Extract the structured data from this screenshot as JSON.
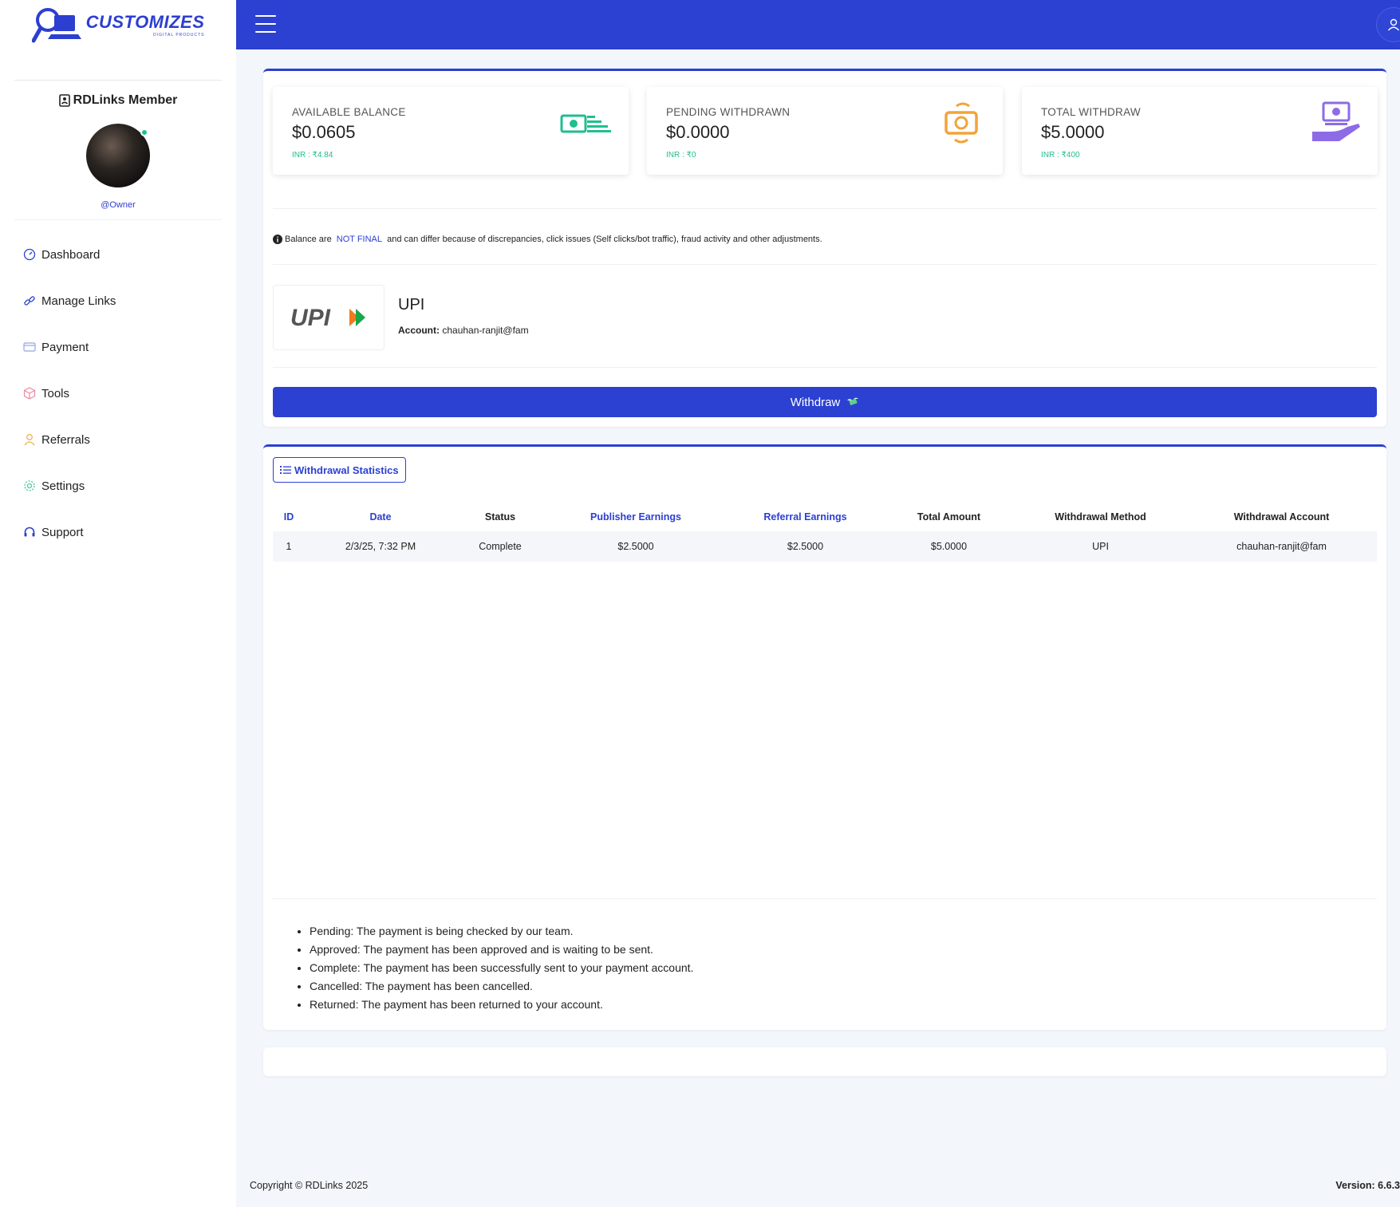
{
  "brand": {
    "name": "CUSTOMIZES",
    "tagline": "DIGITAL PRODUCTS"
  },
  "sidebar": {
    "member_label": "RDLinks Member",
    "username": "@Owner",
    "items": [
      {
        "label": "Dashboard",
        "icon": "gauge-icon"
      },
      {
        "label": "Manage Links",
        "icon": "link-icon"
      },
      {
        "label": "Payment",
        "icon": "card-icon"
      },
      {
        "label": "Tools",
        "icon": "cube-icon"
      },
      {
        "label": "Referrals",
        "icon": "user-icon"
      },
      {
        "label": "Settings",
        "icon": "gear-icon"
      },
      {
        "label": "Support",
        "icon": "headset-icon"
      }
    ]
  },
  "stats": [
    {
      "label": "AVAILABLE BALANCE",
      "value": "$0.0605",
      "inr": "INR : ₹4.84",
      "icon": "cash-stack-icon",
      "color": "#1fbf8f"
    },
    {
      "label": "PENDING WITHDRAWN",
      "value": "$0.0000",
      "inr": "INR : ₹0",
      "icon": "cash-refresh-icon",
      "color": "#f2a33a"
    },
    {
      "label": "TOTAL WITHDRAW",
      "value": "$5.0000",
      "inr": "INR : ₹400",
      "icon": "hand-cash-icon",
      "color": "#8d6be6"
    }
  ],
  "notice": {
    "prefix": "Balance are ",
    "highlight": "NOT FINAL",
    "suffix": " and can differ because of discrepancies, click issues (Self clicks/bot traffic), fraud activity and other adjustments."
  },
  "payment_method": {
    "logo_text": "UPI",
    "name": "UPI",
    "account_label": "Account:",
    "account_value": "chauhan-ranjit@fam"
  },
  "withdraw_button": "Withdraw",
  "withdrawal_stats": {
    "tab_label": "Withdrawal Statistics",
    "columns": [
      "ID",
      "Date",
      "Status",
      "Publisher Earnings",
      "Referral Earnings",
      "Total Amount",
      "Withdrawal Method",
      "Withdrawal Account"
    ],
    "rows": [
      [
        "1",
        "2/3/25, 7:32 PM",
        "Complete",
        "$2.5000",
        "$2.5000",
        "$5.0000",
        "UPI",
        "chauhan-ranjit@fam"
      ]
    ]
  },
  "legend": [
    "Pending: The payment is being checked by our team.",
    "Approved: The payment has been approved and is waiting to be sent.",
    "Complete: The payment has been successfully sent to your payment account.",
    "Cancelled: The payment has been cancelled.",
    "Returned: The payment has been returned to your account."
  ],
  "footer": {
    "copyright": "Copyright © RDLinks 2025",
    "version": "Version: 6.6.3"
  },
  "colors": {
    "primary": "#2c40d2",
    "green": "#1fbf8f",
    "orange": "#f2a33a",
    "purple": "#8d6be6"
  }
}
